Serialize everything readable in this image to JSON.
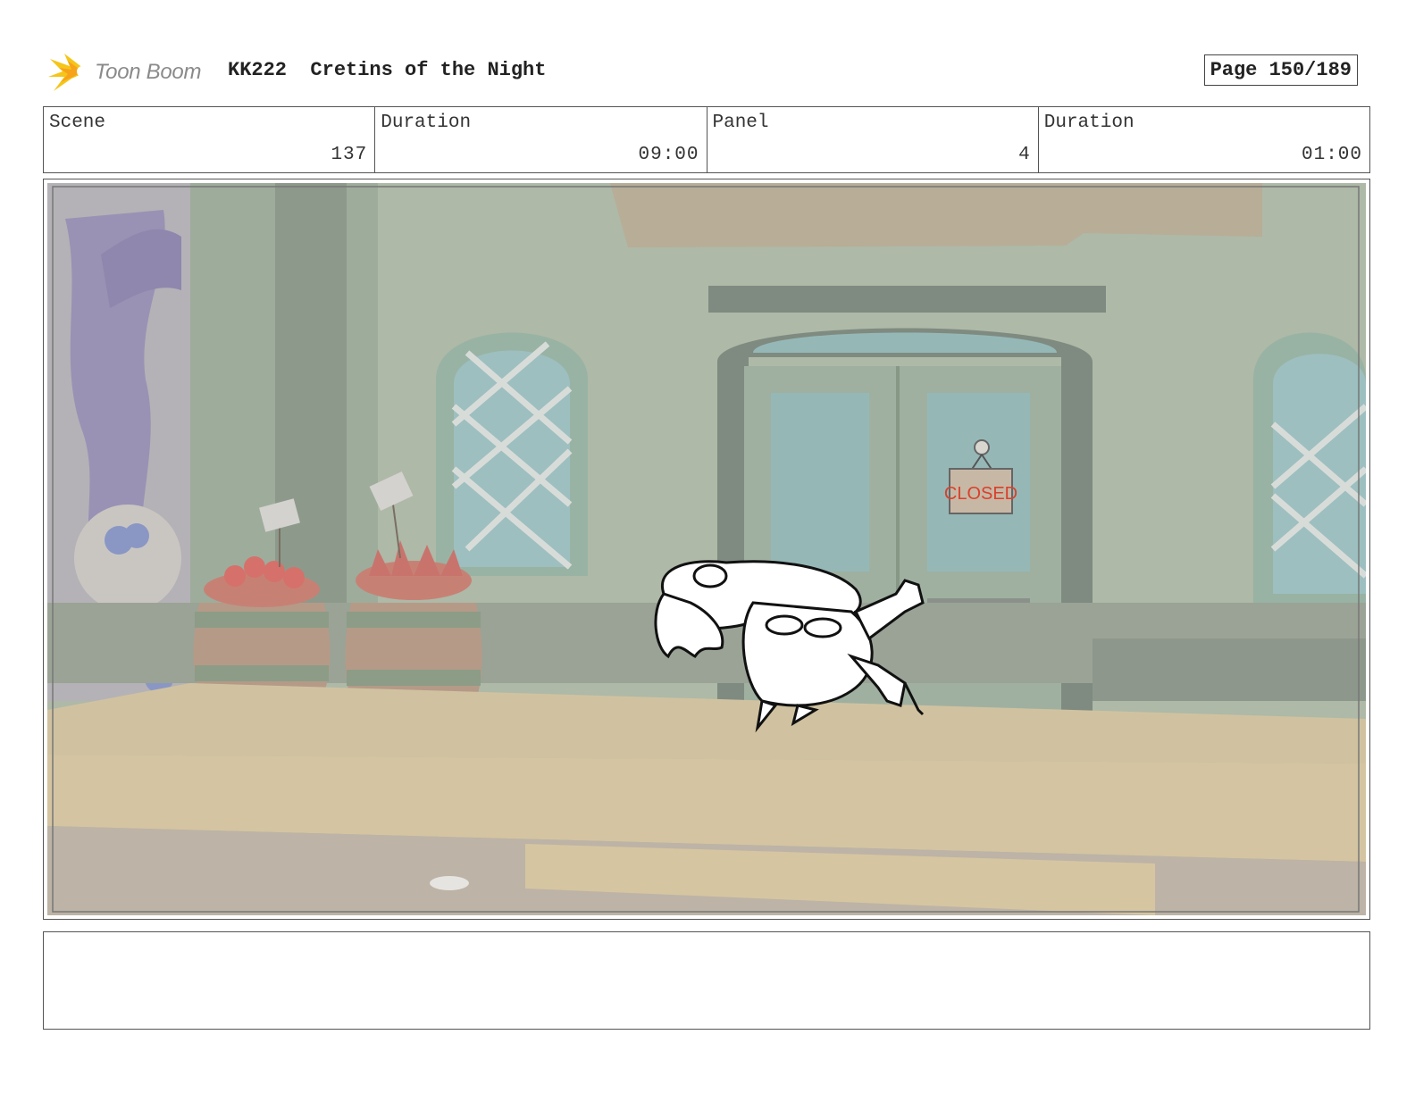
{
  "header": {
    "logo_text": "Toon Boom",
    "production_title": "KK222  Cretins of the Night",
    "page_label": "Page 150/189"
  },
  "info": {
    "scene_label": "Scene",
    "scene_value": "137",
    "scene_duration_label": "Duration",
    "scene_duration_value": "09:00",
    "panel_label": "Panel",
    "panel_value": "4",
    "panel_duration_label": "Duration",
    "panel_duration_value": "01:00"
  },
  "panel": {
    "sign_text": "CLOSED"
  },
  "notes": {
    "text": ""
  }
}
